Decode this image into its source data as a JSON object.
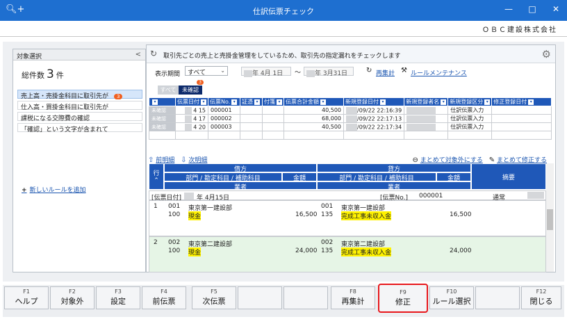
{
  "window": {
    "title": "仕訳伝票チェック",
    "minimize": "—",
    "maximize": "□",
    "close": "✕"
  },
  "company": "ＯＢＣ建設株式会社",
  "left_panel": {
    "header": "対象選択",
    "collapse": "<",
    "count_label": "総件数",
    "count": "3",
    "count_unit": "件",
    "rules": [
      {
        "label": "売上高・売掛金科目に取引先が",
        "badge": "3"
      },
      {
        "label": "仕入高・買掛金科目に取引先が"
      },
      {
        "label": "課税になる交際費の確認"
      },
      {
        "label": "「確認」という文字が含まれて"
      }
    ],
    "add_rule": "新しいルールを追加"
  },
  "info": {
    "text": "取引先ごとの売上と売掛金管理をしているため、取引先の指定漏れをチェックします"
  },
  "filter": {
    "period_label": "表示期間",
    "period_value": "すべて",
    "date_from": "年  4月  1日",
    "date_to": "年  3月31日",
    "recalc": "再集計",
    "rule_maint": "ルールメンテナンス"
  },
  "tabs": {
    "all": "すべて",
    "unconfirmed": "未確認",
    "unconfirmed_badge": "3"
  },
  "voucher_table": {
    "headers": [
      "伝票日付",
      "伝票No.",
      "証憑",
      "付箋",
      "伝票合計金額",
      "新規登録日付",
      "新規登録者名",
      "新規登録区分",
      "修正登録日付"
    ],
    "rows": [
      {
        "status": "未確認",
        "date": "4 15",
        "no": "000001",
        "amount": "40,500",
        "reg_date": "/09/22 22:16:39",
        "kind": "仕訳伝票入力"
      },
      {
        "status": "未確認",
        "date": "4 17",
        "no": "000002",
        "amount": "68,000",
        "reg_date": "/09/22 22:17:13",
        "kind": "仕訳伝票入力"
      },
      {
        "status": "未確認",
        "date": "4 20",
        "no": "000003",
        "amount": "40,500",
        "reg_date": "/09/22 22:17:34",
        "kind": "仕訳伝票入力"
      }
    ]
  },
  "detail": {
    "prev": "前明細",
    "next": "次明細",
    "exclude_all": "まとめて対象外にする",
    "fix_all": "まとめて修正する",
    "row_label": "行",
    "debit": "借方",
    "credit": "貸方",
    "summary": "摘要",
    "account_cols": "部門 / 勘定科目 / 補助科目",
    "amount": "金額",
    "vendor": "業者",
    "date_label": "[伝票日付]",
    "date_value": "年  4月15日",
    "no_label": "[伝票No.]",
    "no_value": "000001",
    "status": "通常",
    "lines": [
      {
        "line": "1",
        "d_dept_code": "001",
        "d_dept": "東京第一建設部",
        "d_acct_code": "100",
        "d_acct": "現金",
        "d_amount": "16,500",
        "c_dept_code": "001",
        "c_dept": "東京第一建設部",
        "c_acct_code": "135",
        "c_acct": "完成工事未収入金",
        "c_amount": "16,500"
      },
      {
        "line": "2",
        "d_dept_code": "002",
        "d_dept": "東京第二建設部",
        "d_acct_code": "100",
        "d_acct": "現金",
        "d_amount": "24,000",
        "c_dept_code": "002",
        "c_dept": "東京第二建設部",
        "c_acct_code": "135",
        "c_acct": "完成工事未収入金",
        "c_amount": "24,000"
      }
    ]
  },
  "fkeys": [
    {
      "key": "F1",
      "label": "ヘルプ"
    },
    {
      "key": "F2",
      "label": "対象外"
    },
    {
      "key": "F3",
      "label": "設定"
    },
    {
      "key": "F4",
      "label": "前伝票"
    },
    {
      "key": "F5",
      "label": "次伝票"
    },
    {
      "key": "",
      "label": ""
    },
    {
      "key": "",
      "label": ""
    },
    {
      "key": "F8",
      "label": "再集計"
    },
    {
      "key": "F9",
      "label": "修正"
    },
    {
      "key": "F10",
      "label": "ルール選択"
    },
    {
      "key": "",
      "label": ""
    },
    {
      "key": "F12",
      "label": "閉じる"
    }
  ],
  "colors": {
    "titlebar": "#1e6fd0",
    "header_blue": "#1f58b8",
    "highlight": "#fff200",
    "badge": "#f06020",
    "focus_border": "#e8161b"
  }
}
